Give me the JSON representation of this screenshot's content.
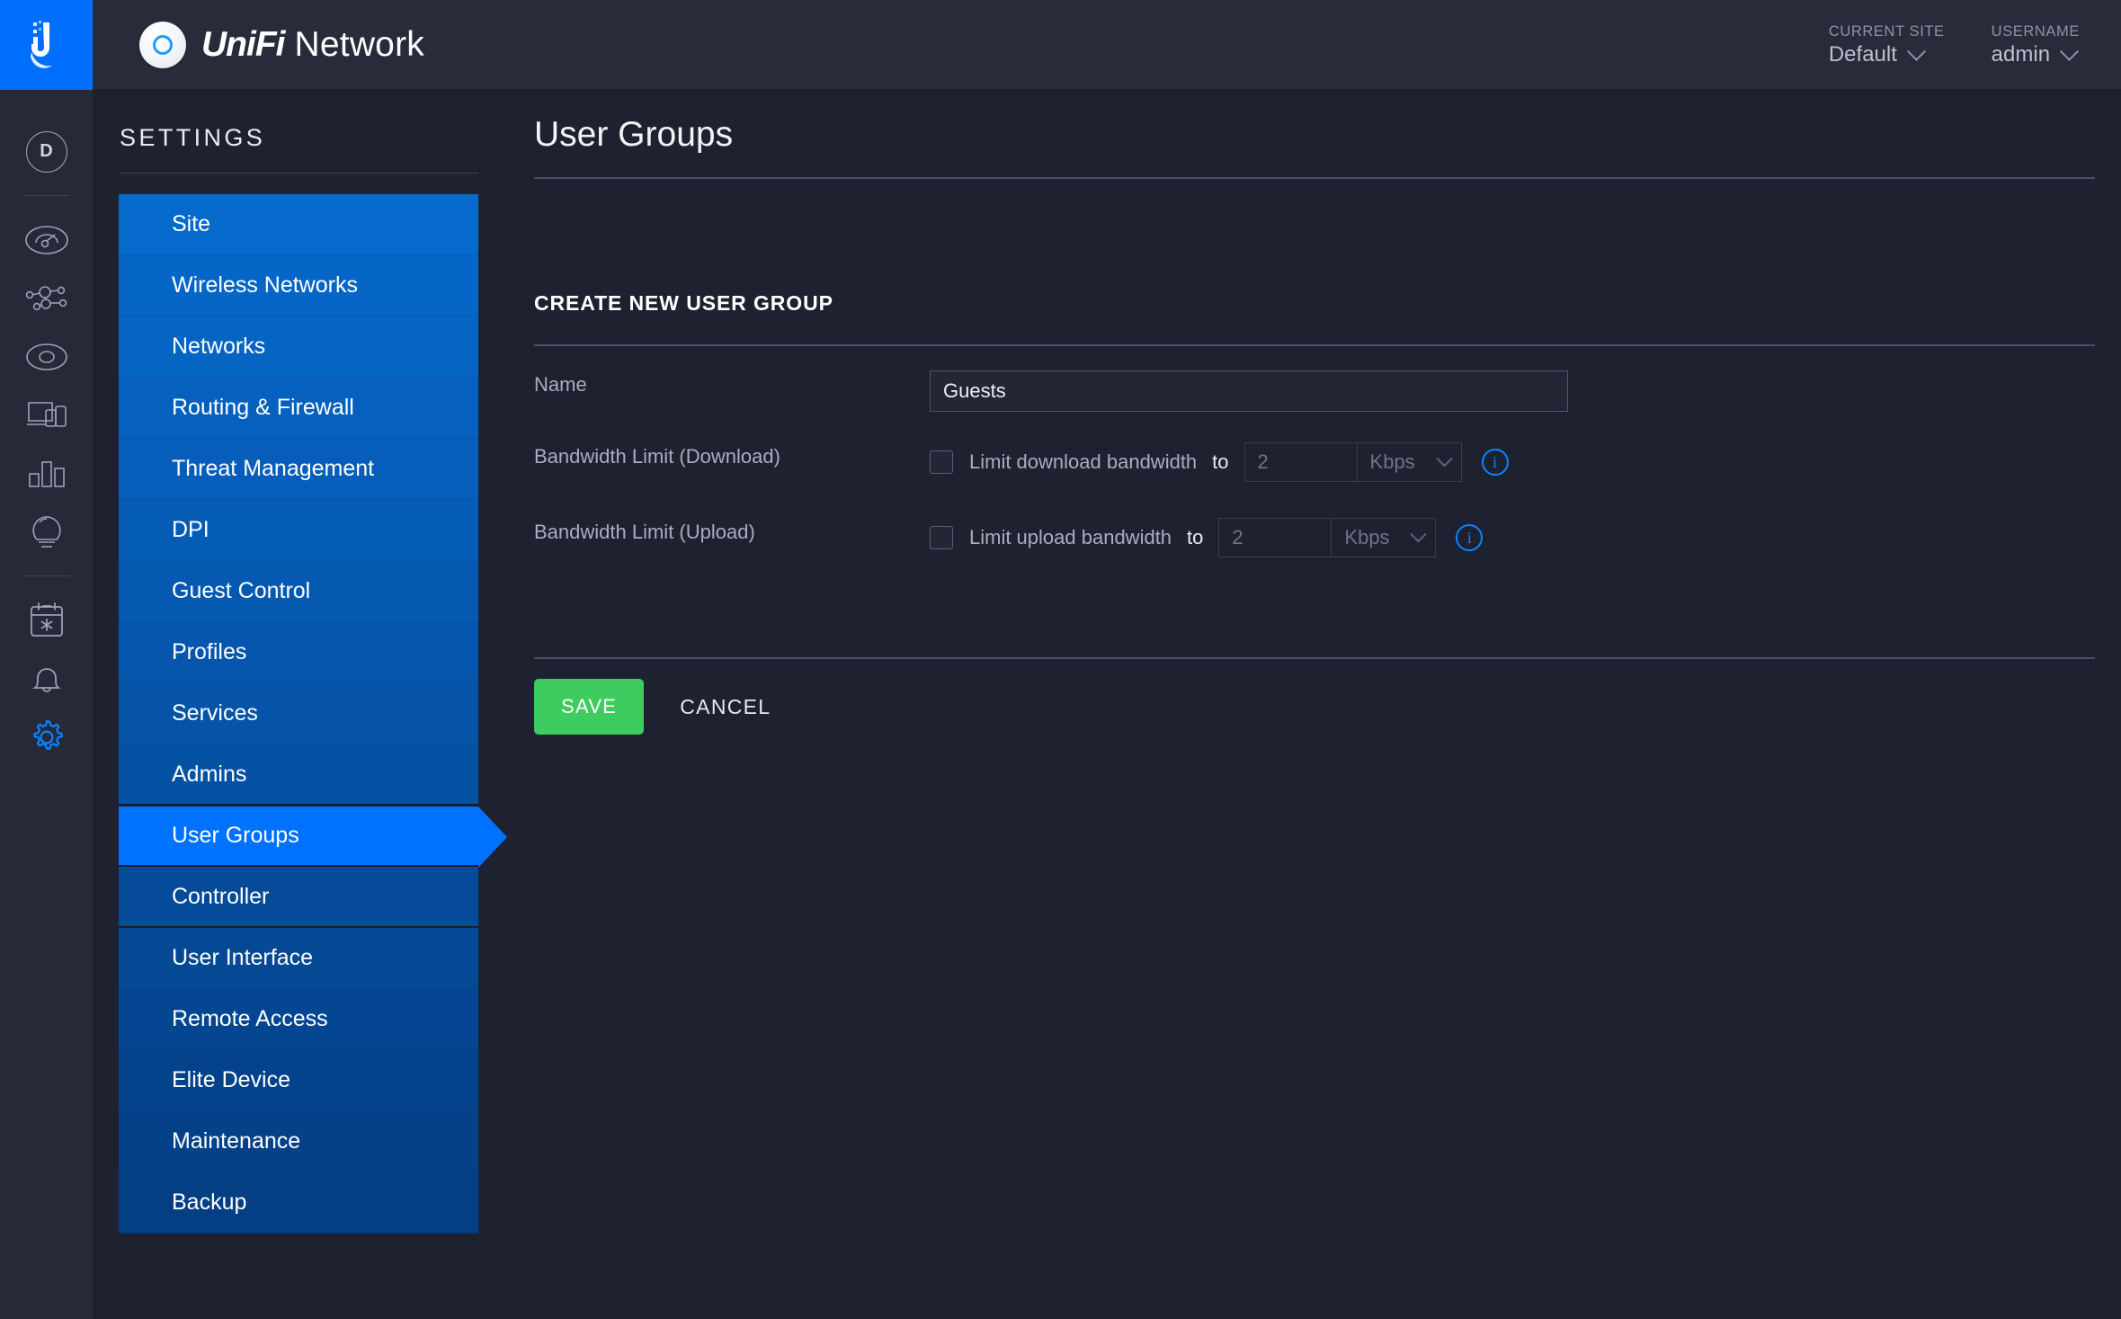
{
  "topbar": {
    "logo_icon": "ubiquiti-u-logo",
    "ap_icon": "unifi-ap-icon",
    "brand_unifi": "UniFi",
    "brand_network": "Network",
    "current_site_label": "CURRENT SITE",
    "current_site_value": "Default",
    "username_label": "USERNAME",
    "username_value": "admin"
  },
  "rail": {
    "avatar_initial": "D",
    "items": [
      {
        "name": "dashboard",
        "icon": "speedometer-icon"
      },
      {
        "name": "topology",
        "icon": "topology-icon"
      },
      {
        "name": "devices",
        "icon": "device-circle-icon"
      },
      {
        "name": "clients",
        "icon": "clients-screens-icon"
      },
      {
        "name": "statistics",
        "icon": "bar-chart-icon"
      },
      {
        "name": "insights",
        "icon": "lightbulb-icon"
      },
      {
        "name": "events",
        "icon": "calendar-star-icon"
      },
      {
        "name": "alerts",
        "icon": "bell-icon"
      },
      {
        "name": "settings",
        "icon": "gear-icon"
      }
    ]
  },
  "sidebar": {
    "title": "SETTINGS",
    "items": [
      {
        "label": "Site"
      },
      {
        "label": "Wireless Networks"
      },
      {
        "label": "Networks"
      },
      {
        "label": "Routing & Firewall"
      },
      {
        "label": "Threat Management"
      },
      {
        "label": "DPI"
      },
      {
        "label": "Guest Control"
      },
      {
        "label": "Profiles"
      },
      {
        "label": "Services"
      },
      {
        "label": "Admins"
      },
      {
        "label": "User Groups"
      },
      {
        "label": "Controller"
      },
      {
        "label": "User Interface"
      },
      {
        "label": "Remote Access"
      },
      {
        "label": "Elite Device"
      },
      {
        "label": "Maintenance"
      },
      {
        "label": "Backup"
      }
    ],
    "active_index": 10
  },
  "main": {
    "page_title": "User Groups",
    "section_title": "CREATE NEW USER GROUP",
    "name_label": "Name",
    "name_value": "Guests",
    "name_placeholder": "",
    "download": {
      "label": "Bandwidth Limit (Download)",
      "checkbox_text": "Limit download bandwidth",
      "checked": false,
      "to_word": "to",
      "value_placeholder": "2",
      "value": "",
      "unit": "Kbps",
      "info_icon": "info-icon"
    },
    "upload": {
      "label": "Bandwidth Limit (Upload)",
      "checkbox_text": "Limit upload bandwidth",
      "checked": false,
      "to_word": "to",
      "value_placeholder": "2",
      "value": "",
      "unit": "Kbps",
      "info_icon": "info-icon"
    },
    "save_label": "SAVE",
    "cancel_label": "CANCEL"
  },
  "colors": {
    "accent_blue": "#0072ff",
    "sidebar_blue": "#0559b8",
    "save_green": "#3ecb60",
    "page_bg": "#1e2230",
    "rail_bg": "#262a38",
    "topbar_bg": "#282c3a"
  }
}
